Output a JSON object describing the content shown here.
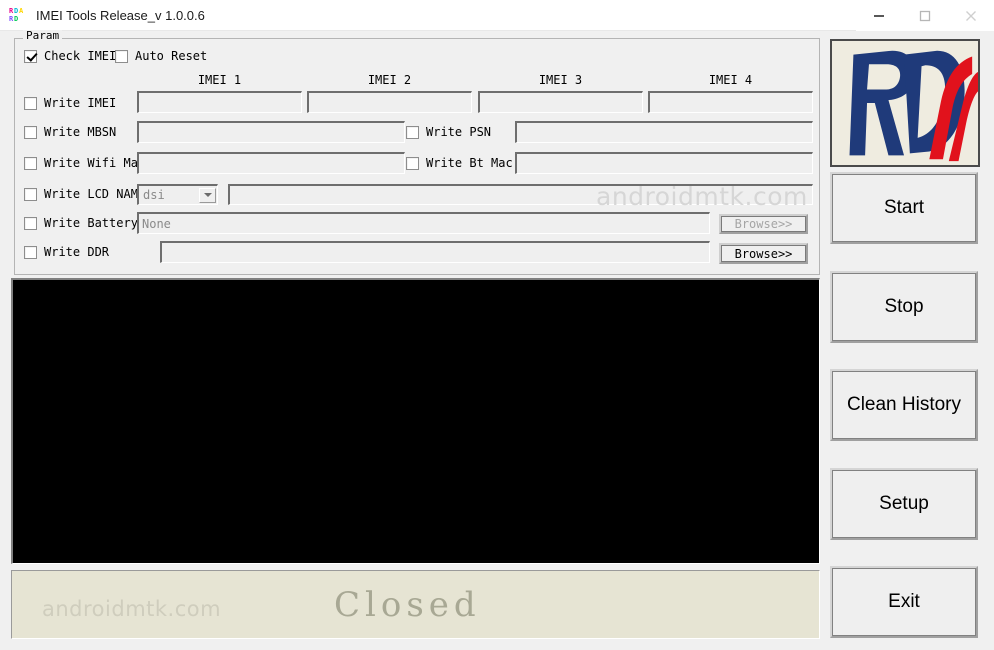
{
  "window": {
    "title": "IMEI Tools Release_v 1.0.0.6",
    "icon_name": "rda-app-icon",
    "controls": {
      "minimize": "minimize-icon",
      "maximize": "maximize-icon",
      "close": "close-icon"
    }
  },
  "param_group": {
    "legend": "Param",
    "top_checkboxes": [
      {
        "label": "Check IMEI",
        "checked": true
      },
      {
        "label": "Auto Reset",
        "checked": false
      }
    ],
    "imei_headers": [
      "IMEI 1",
      "IMEI 2",
      "IMEI 3",
      "IMEI 4"
    ],
    "imei_values": [
      "",
      "",
      "",
      ""
    ],
    "rows": [
      {
        "label": "Write IMEI",
        "checked": false,
        "value": ""
      },
      {
        "label": "Write MBSN",
        "checked": false,
        "value": ""
      },
      {
        "label": "Write Wifi Mac",
        "checked": false,
        "value": ""
      },
      {
        "label": "Write LCD NAME",
        "checked": false,
        "value": "dsi"
      },
      {
        "label": "Write Battery",
        "checked": false,
        "value": "None"
      },
      {
        "label": "Write DDR",
        "checked": false,
        "value": ""
      }
    ],
    "right_checkboxes": [
      {
        "label": "Write PSN",
        "checked": false,
        "value": ""
      },
      {
        "label": "Write Bt Mac",
        "checked": false,
        "value": ""
      }
    ],
    "browse_buttons": [
      {
        "label": "Browse>>",
        "enabled": false
      },
      {
        "label": "Browse>>",
        "enabled": true
      }
    ],
    "lcd_name_selected": "dsi"
  },
  "actions": {
    "logo_alt": "RDA",
    "buttons": [
      {
        "label": "Start"
      },
      {
        "label": "Stop"
      },
      {
        "label": "Clean History"
      },
      {
        "label": "Setup"
      },
      {
        "label": "Exit"
      }
    ]
  },
  "log_panel": {
    "content": ""
  },
  "status": {
    "text": "Closed"
  },
  "watermark": {
    "text": "androidmtk.com"
  },
  "colors": {
    "logo_blue": "#1f3a7a",
    "logo_red": "#e1121c",
    "logo_bg": "#efece0",
    "status_bg": "#e6e4d3",
    "status_fg": "#a8a894",
    "window_bg": "#f0f0f0"
  }
}
